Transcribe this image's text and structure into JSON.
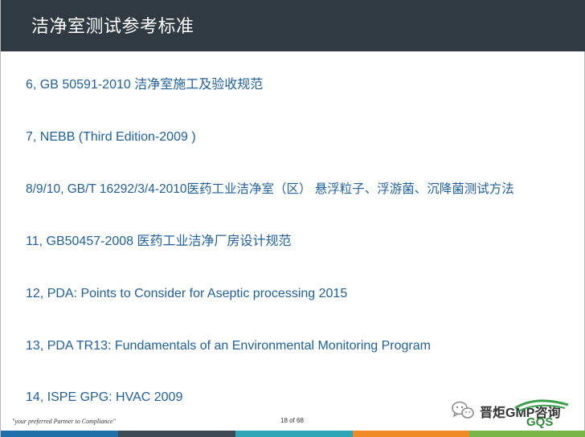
{
  "header": {
    "title": "洁净室测试参考标准"
  },
  "items": [
    "6, GB 50591-2010 洁净室施工及验收规范",
    "7, NEBB (Third Edition-2009 )",
    "8/9/10, GB/T 16292/3/4-2010医药工业洁净室（区） 悬浮粒子、浮游菌、沉降菌测试方法",
    "11, GB50457-2008 医药工业洁净厂房设计规范",
    "12, PDA: Points to Consider for Aseptic processing 2015",
    "13, PDA TR13: Fundamentals of an Environmental Monitoring Program",
    "14, ISPE GPG: HVAC 2009"
  ],
  "footer": {
    "tagline": "\"your preferred Partner to Compliance\"",
    "page": "18 of 68",
    "brand": "晋炬GMP咨询",
    "logo_text": "GQS"
  },
  "colors": {
    "header_bg": "#2f3a42",
    "item_text": "#1f5f9b",
    "strip": [
      "#1f6fa8",
      "#3d4b55",
      "#2ea6b5",
      "#f08a24",
      "#7ab648"
    ]
  }
}
